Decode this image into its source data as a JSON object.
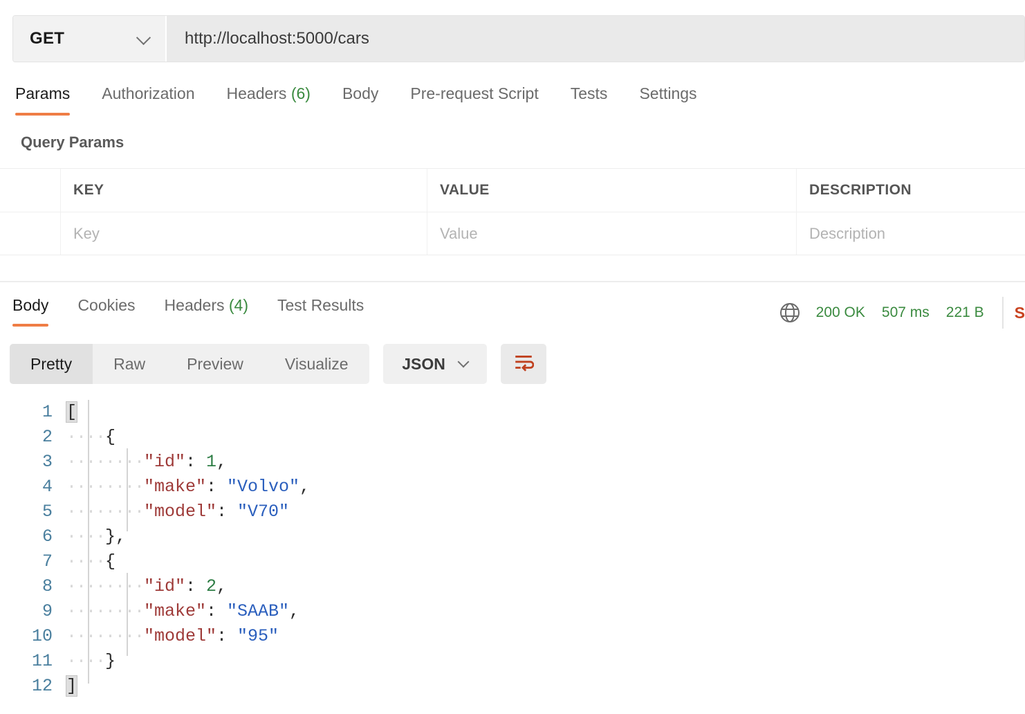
{
  "request": {
    "method": "GET",
    "method_chevron_icon": "chevron-down-icon",
    "url": "http://localhost:5000/cars",
    "tabs": [
      {
        "label": "Params",
        "count": "",
        "active": true
      },
      {
        "label": "Authorization",
        "count": "",
        "active": false
      },
      {
        "label": "Headers",
        "count": "(6)",
        "active": false
      },
      {
        "label": "Body",
        "count": "",
        "active": false
      },
      {
        "label": "Pre-request Script",
        "count": "",
        "active": false
      },
      {
        "label": "Tests",
        "count": "",
        "active": false
      },
      {
        "label": "Settings",
        "count": "",
        "active": false
      }
    ]
  },
  "query_params": {
    "title": "Query Params",
    "columns": [
      "",
      "KEY",
      "VALUE",
      "DESCRIPTION"
    ],
    "rows": [
      {
        "key": "",
        "value": "",
        "description": ""
      }
    ],
    "placeholders": {
      "key": "Key",
      "value": "Value",
      "description": "Description"
    }
  },
  "response": {
    "tabs": [
      {
        "label": "Body",
        "count": "",
        "active": true
      },
      {
        "label": "Cookies",
        "count": "",
        "active": false
      },
      {
        "label": "Headers",
        "count": "(4)",
        "active": false
      },
      {
        "label": "Test Results",
        "count": "",
        "active": false
      }
    ],
    "network_icon": "globe-icon",
    "status": "200 OK",
    "time": "507 ms",
    "size": "221 B",
    "save_response": "S",
    "view_modes": [
      {
        "label": "Pretty",
        "active": true
      },
      {
        "label": "Raw",
        "active": false
      },
      {
        "label": "Preview",
        "active": false
      },
      {
        "label": "Visualize",
        "active": false
      }
    ],
    "format": "JSON",
    "format_chevron_icon": "chevron-down-icon",
    "wrap_icon": "word-wrap-icon"
  },
  "colors": {
    "accent": "#ef7d45",
    "status_green": "#3a8a3f",
    "save_red": "#c8421f",
    "json_key": "#9e3a38",
    "json_string": "#2b5fbd",
    "json_number": "#2e7d45",
    "line_number": "#4a7f9e"
  },
  "code": {
    "language": "json",
    "line_count": 12,
    "lines": [
      {
        "n": "1",
        "tokens": [
          {
            "t": "[",
            "c": "brk"
          }
        ]
      },
      {
        "n": "2",
        "tokens": [
          {
            "t": "....",
            "c": "ind"
          },
          {
            "t": "{",
            "c": "pun"
          }
        ]
      },
      {
        "n": "3",
        "tokens": [
          {
            "t": "........",
            "c": "ind"
          },
          {
            "t": "\"id\"",
            "c": "key"
          },
          {
            "t": ": ",
            "c": "pun"
          },
          {
            "t": "1",
            "c": "num"
          },
          {
            "t": ",",
            "c": "pun"
          }
        ]
      },
      {
        "n": "4",
        "tokens": [
          {
            "t": "........",
            "c": "ind"
          },
          {
            "t": "\"make\"",
            "c": "key"
          },
          {
            "t": ": ",
            "c": "pun"
          },
          {
            "t": "\"Volvo\"",
            "c": "str"
          },
          {
            "t": ",",
            "c": "pun"
          }
        ]
      },
      {
        "n": "5",
        "tokens": [
          {
            "t": "........",
            "c": "ind"
          },
          {
            "t": "\"model\"",
            "c": "key"
          },
          {
            "t": ": ",
            "c": "pun"
          },
          {
            "t": "\"V70\"",
            "c": "str"
          }
        ]
      },
      {
        "n": "6",
        "tokens": [
          {
            "t": "....",
            "c": "ind"
          },
          {
            "t": "},",
            "c": "pun"
          }
        ]
      },
      {
        "n": "7",
        "tokens": [
          {
            "t": "....",
            "c": "ind"
          },
          {
            "t": "{",
            "c": "pun"
          }
        ]
      },
      {
        "n": "8",
        "tokens": [
          {
            "t": "........",
            "c": "ind"
          },
          {
            "t": "\"id\"",
            "c": "key"
          },
          {
            "t": ": ",
            "c": "pun"
          },
          {
            "t": "2",
            "c": "num"
          },
          {
            "t": ",",
            "c": "pun"
          }
        ]
      },
      {
        "n": "9",
        "tokens": [
          {
            "t": "........",
            "c": "ind"
          },
          {
            "t": "\"make\"",
            "c": "key"
          },
          {
            "t": ": ",
            "c": "pun"
          },
          {
            "t": "\"SAAB\"",
            "c": "str"
          },
          {
            "t": ",",
            "c": "pun"
          }
        ]
      },
      {
        "n": "10",
        "tokens": [
          {
            "t": "........",
            "c": "ind"
          },
          {
            "t": "\"model\"",
            "c": "key"
          },
          {
            "t": ": ",
            "c": "pun"
          },
          {
            "t": "\"95\"",
            "c": "str"
          }
        ]
      },
      {
        "n": "11",
        "tokens": [
          {
            "t": "....",
            "c": "ind"
          },
          {
            "t": "}",
            "c": "pun"
          }
        ]
      },
      {
        "n": "12",
        "tokens": [
          {
            "t": "]",
            "c": "brk"
          }
        ]
      }
    ]
  }
}
